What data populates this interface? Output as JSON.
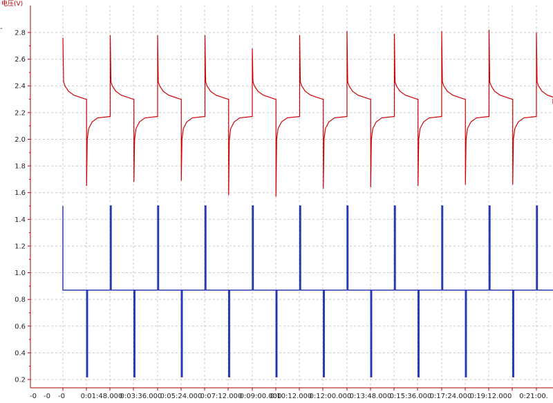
{
  "chart_data": {
    "type": "line",
    "title": "",
    "ylabel": "电压(V)",
    "xlabel": "",
    "ylim": [
      0.2,
      2.9
    ],
    "yticks": [
      0.2,
      0.4,
      0.6,
      0.8,
      1.0,
      1.2,
      1.4,
      1.6,
      1.8,
      2.0,
      2.2,
      2.4,
      2.6,
      2.8
    ],
    "ytick_labels": [
      "0.2",
      "0.4",
      "0.6",
      "0.8",
      "1.0",
      "1.2",
      "1.4",
      "1.6",
      "1.8",
      "2.0",
      "2.2",
      "2.4",
      "2.6",
      "2.8"
    ],
    "xtick_labels": [
      "-0",
      "-0",
      "-0",
      "0:01:48.000",
      "0:03:36.000",
      "0:05:24.000",
      "0:07:12.000",
      "0:09:00.000",
      "0:10:12.000",
      "0:12:00.000",
      "0:13:48.000",
      "0:15:36.000",
      "0:17:24.000",
      "0:19:12.000",
      "0:21:00."
    ],
    "grid": true,
    "series": [
      {
        "color": "#cc0000",
        "pulse_times": [
          "0:00:00",
          "0:01:48",
          "0:03:36",
          "0:05:24",
          "0:07:12",
          "0:09:00",
          "0:10:48",
          "0:12:36",
          "0:14:24",
          "0:16:12",
          "0:18:00",
          "0:19:48"
        ],
        "peak_values": [
          2.76,
          2.78,
          2.78,
          2.78,
          2.68,
          2.78,
          2.81,
          2.79,
          2.81,
          2.82,
          2.8,
          2.83
        ],
        "plateau_high": 2.3,
        "dip_values": [
          1.65,
          1.68,
          1.69,
          1.58,
          1.57,
          1.63,
          1.64,
          1.65,
          1.66,
          1.66,
          1.67
        ],
        "plateau_low": 2.17
      },
      {
        "color": "#1a2fb0",
        "baseline": 0.87,
        "high": 1.5,
        "low": 0.22
      }
    ]
  }
}
